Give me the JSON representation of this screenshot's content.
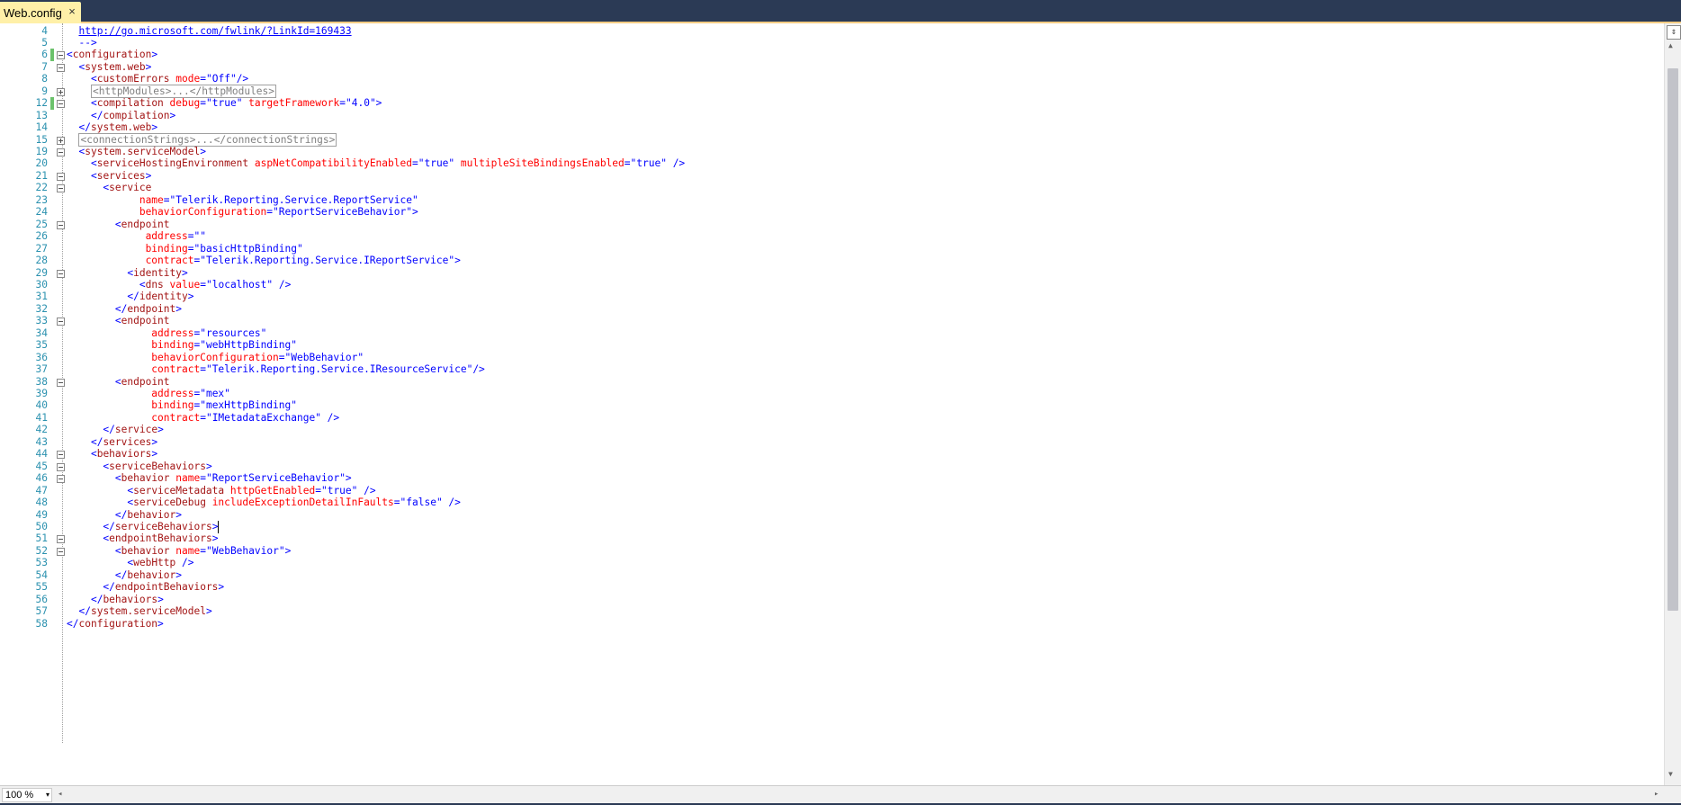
{
  "tab": {
    "title": "Web.config",
    "close_glyph": "×"
  },
  "zoom": {
    "value": "100 %",
    "dropdown_glyph": "▾"
  },
  "scroll": {
    "split_glyph": "⇕",
    "up_glyph": "▲",
    "down_glyph": "▼",
    "left_glyph": "◂",
    "right_glyph": "▸"
  },
  "colors": {
    "element": "#a31515",
    "attribute": "#ff0000",
    "value": "#0000ff",
    "line_number": "#2b91af",
    "change_bar": "#6cc26c"
  },
  "lines": [
    {
      "n": "4",
      "indent": 1,
      "fold": "",
      "chg": false,
      "tokens": [
        [
          "u",
          "http://go.microsoft.com/fwlink/?LinkId=169433"
        ]
      ]
    },
    {
      "n": "5",
      "indent": 1,
      "fold": "",
      "chg": false,
      "tokens": [
        [
          "b",
          "-->"
        ]
      ]
    },
    {
      "n": "6",
      "indent": 0,
      "fold": "minus",
      "chg": true,
      "tokens": [
        [
          "b",
          "<"
        ],
        [
          "t",
          "configuration"
        ],
        [
          "b",
          ">"
        ]
      ]
    },
    {
      "n": "7",
      "indent": 1,
      "fold": "minus",
      "chg": false,
      "tokens": [
        [
          "b",
          "<"
        ],
        [
          "t",
          "system.web"
        ],
        [
          "b",
          ">"
        ]
      ]
    },
    {
      "n": "8",
      "indent": 2,
      "fold": "",
      "chg": false,
      "tokens": [
        [
          "b",
          "<"
        ],
        [
          "t",
          "customErrors"
        ],
        [
          "b",
          " "
        ],
        [
          "a",
          "mode"
        ],
        [
          "b",
          "="
        ],
        [
          "b",
          "\""
        ],
        [
          "v",
          "Off"
        ],
        [
          "b",
          "\"/>"
        ]
      ]
    },
    {
      "n": "9",
      "indent": 2,
      "fold": "plus",
      "chg": false,
      "tokens": [
        [
          "c",
          "<httpModules>...</httpModules>"
        ]
      ]
    },
    {
      "n": "12",
      "indent": 2,
      "fold": "minus",
      "chg": true,
      "tokens": [
        [
          "b",
          "<"
        ],
        [
          "t",
          "compilation"
        ],
        [
          "b",
          " "
        ],
        [
          "a",
          "debug"
        ],
        [
          "b",
          "="
        ],
        [
          "b",
          "\""
        ],
        [
          "v",
          "true"
        ],
        [
          "b",
          "\" "
        ],
        [
          "a",
          "targetFramework"
        ],
        [
          "b",
          "="
        ],
        [
          "b",
          "\""
        ],
        [
          "v",
          "4.0"
        ],
        [
          "b",
          "\">"
        ]
      ]
    },
    {
      "n": "13",
      "indent": 2,
      "fold": "",
      "chg": false,
      "tokens": [
        [
          "b",
          "</"
        ],
        [
          "t",
          "compilation"
        ],
        [
          "b",
          ">"
        ]
      ]
    },
    {
      "n": "14",
      "indent": 1,
      "fold": "",
      "chg": false,
      "tokens": [
        [
          "b",
          "</"
        ],
        [
          "t",
          "system.web"
        ],
        [
          "b",
          ">"
        ]
      ]
    },
    {
      "n": "15",
      "indent": 1,
      "fold": "plus",
      "chg": false,
      "tokens": [
        [
          "c",
          "<connectionStrings>...</connectionStrings>"
        ]
      ]
    },
    {
      "n": "19",
      "indent": 1,
      "fold": "minus",
      "chg": false,
      "tokens": [
        [
          "b",
          "<"
        ],
        [
          "t",
          "system.serviceModel"
        ],
        [
          "b",
          ">"
        ]
      ]
    },
    {
      "n": "20",
      "indent": 2,
      "fold": "",
      "chg": false,
      "tokens": [
        [
          "b",
          "<"
        ],
        [
          "t",
          "serviceHostingEnvironment"
        ],
        [
          "b",
          " "
        ],
        [
          "a",
          "aspNetCompatibilityEnabled"
        ],
        [
          "b",
          "="
        ],
        [
          "b",
          "\""
        ],
        [
          "v",
          "true"
        ],
        [
          "b",
          "\" "
        ],
        [
          "a",
          "multipleSiteBindingsEnabled"
        ],
        [
          "b",
          "="
        ],
        [
          "b",
          "\""
        ],
        [
          "v",
          "true"
        ],
        [
          "b",
          "\" />"
        ]
      ]
    },
    {
      "n": "21",
      "indent": 2,
      "fold": "minus",
      "chg": false,
      "tokens": [
        [
          "b",
          "<"
        ],
        [
          "t",
          "services"
        ],
        [
          "b",
          ">"
        ]
      ]
    },
    {
      "n": "22",
      "indent": 3,
      "fold": "minus",
      "chg": false,
      "tokens": [
        [
          "b",
          "<"
        ],
        [
          "t",
          "service"
        ]
      ]
    },
    {
      "n": "23",
      "indent": 0,
      "pad": "            ",
      "fold": "",
      "chg": false,
      "tokens": [
        [
          "a",
          "name"
        ],
        [
          "b",
          "="
        ],
        [
          "b",
          "\""
        ],
        [
          "v",
          "Telerik.Reporting.Service.ReportService"
        ],
        [
          "b",
          "\""
        ]
      ]
    },
    {
      "n": "24",
      "indent": 0,
      "pad": "            ",
      "fold": "",
      "chg": false,
      "tokens": [
        [
          "a",
          "behaviorConfiguration"
        ],
        [
          "b",
          "="
        ],
        [
          "b",
          "\""
        ],
        [
          "v",
          "ReportServiceBehavior"
        ],
        [
          "b",
          "\">"
        ]
      ]
    },
    {
      "n": "25",
      "indent": 4,
      "fold": "minus",
      "chg": false,
      "tokens": [
        [
          "b",
          "<"
        ],
        [
          "t",
          "endpoint"
        ]
      ]
    },
    {
      "n": "26",
      "indent": 0,
      "pad": "             ",
      "fold": "",
      "chg": false,
      "tokens": [
        [
          "a",
          "address"
        ],
        [
          "b",
          "="
        ],
        [
          "b",
          "\"\""
        ]
      ]
    },
    {
      "n": "27",
      "indent": 0,
      "pad": "             ",
      "fold": "",
      "chg": false,
      "tokens": [
        [
          "a",
          "binding"
        ],
        [
          "b",
          "="
        ],
        [
          "b",
          "\""
        ],
        [
          "v",
          "basicHttpBinding"
        ],
        [
          "b",
          "\""
        ]
      ]
    },
    {
      "n": "28",
      "indent": 0,
      "pad": "             ",
      "fold": "",
      "chg": false,
      "tokens": [
        [
          "a",
          "contract"
        ],
        [
          "b",
          "="
        ],
        [
          "b",
          "\""
        ],
        [
          "v",
          "Telerik.Reporting.Service.IReportService"
        ],
        [
          "b",
          "\">"
        ]
      ]
    },
    {
      "n": "29",
      "indent": 5,
      "fold": "minus",
      "chg": false,
      "tokens": [
        [
          "b",
          "<"
        ],
        [
          "t",
          "identity"
        ],
        [
          "b",
          ">"
        ]
      ]
    },
    {
      "n": "30",
      "indent": 6,
      "fold": "",
      "chg": false,
      "tokens": [
        [
          "b",
          "<"
        ],
        [
          "t",
          "dns"
        ],
        [
          "b",
          " "
        ],
        [
          "a",
          "value"
        ],
        [
          "b",
          "="
        ],
        [
          "b",
          "\""
        ],
        [
          "v",
          "localhost"
        ],
        [
          "b",
          "\" />"
        ]
      ]
    },
    {
      "n": "31",
      "indent": 5,
      "fold": "",
      "chg": false,
      "tokens": [
        [
          "b",
          "</"
        ],
        [
          "t",
          "identity"
        ],
        [
          "b",
          ">"
        ]
      ]
    },
    {
      "n": "32",
      "indent": 4,
      "fold": "",
      "chg": false,
      "tokens": [
        [
          "b",
          "</"
        ],
        [
          "t",
          "endpoint"
        ],
        [
          "b",
          ">"
        ]
      ]
    },
    {
      "n": "33",
      "indent": 4,
      "fold": "minus",
      "chg": false,
      "tokens": [
        [
          "b",
          "<"
        ],
        [
          "t",
          "endpoint"
        ]
      ]
    },
    {
      "n": "34",
      "indent": 0,
      "pad": "              ",
      "fold": "",
      "chg": false,
      "tokens": [
        [
          "a",
          "address"
        ],
        [
          "b",
          "="
        ],
        [
          "b",
          "\""
        ],
        [
          "v",
          "resources"
        ],
        [
          "b",
          "\""
        ]
      ]
    },
    {
      "n": "35",
      "indent": 0,
      "pad": "              ",
      "fold": "",
      "chg": false,
      "tokens": [
        [
          "a",
          "binding"
        ],
        [
          "b",
          "="
        ],
        [
          "b",
          "\""
        ],
        [
          "v",
          "webHttpBinding"
        ],
        [
          "b",
          "\""
        ]
      ]
    },
    {
      "n": "36",
      "indent": 0,
      "pad": "              ",
      "fold": "",
      "chg": false,
      "tokens": [
        [
          "a",
          "behaviorConfiguration"
        ],
        [
          "b",
          "="
        ],
        [
          "b",
          "\""
        ],
        [
          "v",
          "WebBehavior"
        ],
        [
          "b",
          "\""
        ]
      ]
    },
    {
      "n": "37",
      "indent": 0,
      "pad": "              ",
      "fold": "",
      "chg": false,
      "tokens": [
        [
          "a",
          "contract"
        ],
        [
          "b",
          "="
        ],
        [
          "b",
          "\""
        ],
        [
          "v",
          "Telerik.Reporting.Service.IResourceService"
        ],
        [
          "b",
          "\"/>"
        ]
      ]
    },
    {
      "n": "38",
      "indent": 4,
      "fold": "minus",
      "chg": false,
      "tokens": [
        [
          "b",
          "<"
        ],
        [
          "t",
          "endpoint"
        ]
      ]
    },
    {
      "n": "39",
      "indent": 0,
      "pad": "              ",
      "fold": "",
      "chg": false,
      "tokens": [
        [
          "a",
          "address"
        ],
        [
          "b",
          "="
        ],
        [
          "b",
          "\""
        ],
        [
          "v",
          "mex"
        ],
        [
          "b",
          "\""
        ]
      ]
    },
    {
      "n": "40",
      "indent": 0,
      "pad": "              ",
      "fold": "",
      "chg": false,
      "tokens": [
        [
          "a",
          "binding"
        ],
        [
          "b",
          "="
        ],
        [
          "b",
          "\""
        ],
        [
          "v",
          "mexHttpBinding"
        ],
        [
          "b",
          "\""
        ]
      ]
    },
    {
      "n": "41",
      "indent": 0,
      "pad": "              ",
      "fold": "",
      "chg": false,
      "tokens": [
        [
          "a",
          "contract"
        ],
        [
          "b",
          "="
        ],
        [
          "b",
          "\""
        ],
        [
          "v",
          "IMetadataExchange"
        ],
        [
          "b",
          "\" />"
        ]
      ]
    },
    {
      "n": "42",
      "indent": 3,
      "fold": "",
      "chg": false,
      "tokens": [
        [
          "b",
          "</"
        ],
        [
          "t",
          "service"
        ],
        [
          "b",
          ">"
        ]
      ]
    },
    {
      "n": "43",
      "indent": 2,
      "fold": "",
      "chg": false,
      "tokens": [
        [
          "b",
          "</"
        ],
        [
          "t",
          "services"
        ],
        [
          "b",
          ">"
        ]
      ]
    },
    {
      "n": "44",
      "indent": 2,
      "fold": "minus",
      "chg": false,
      "tokens": [
        [
          "b",
          "<"
        ],
        [
          "t",
          "behaviors"
        ],
        [
          "b",
          ">"
        ]
      ]
    },
    {
      "n": "45",
      "indent": 3,
      "fold": "minus",
      "chg": false,
      "tokens": [
        [
          "b",
          "<"
        ],
        [
          "t",
          "serviceBehaviors"
        ],
        [
          "b",
          ">"
        ]
      ]
    },
    {
      "n": "46",
      "indent": 4,
      "fold": "minus",
      "chg": false,
      "tokens": [
        [
          "b",
          "<"
        ],
        [
          "t",
          "behavior"
        ],
        [
          "b",
          " "
        ],
        [
          "a",
          "name"
        ],
        [
          "b",
          "="
        ],
        [
          "b",
          "\""
        ],
        [
          "v",
          "ReportServiceBehavior"
        ],
        [
          "b",
          "\">"
        ]
      ]
    },
    {
      "n": "47",
      "indent": 5,
      "fold": "",
      "chg": false,
      "tokens": [
        [
          "b",
          "<"
        ],
        [
          "t",
          "serviceMetadata"
        ],
        [
          "b",
          " "
        ],
        [
          "a",
          "httpGetEnabled"
        ],
        [
          "b",
          "="
        ],
        [
          "b",
          "\""
        ],
        [
          "v",
          "true"
        ],
        [
          "b",
          "\" />"
        ]
      ]
    },
    {
      "n": "48",
      "indent": 5,
      "fold": "",
      "chg": false,
      "tokens": [
        [
          "b",
          "<"
        ],
        [
          "t",
          "serviceDebug"
        ],
        [
          "b",
          " "
        ],
        [
          "a",
          "includeExceptionDetailInFaults"
        ],
        [
          "b",
          "="
        ],
        [
          "b",
          "\""
        ],
        [
          "v",
          "false"
        ],
        [
          "b",
          "\" />"
        ]
      ]
    },
    {
      "n": "49",
      "indent": 4,
      "fold": "",
      "chg": false,
      "tokens": [
        [
          "b",
          "</"
        ],
        [
          "t",
          "behavior"
        ],
        [
          "b",
          ">"
        ]
      ]
    },
    {
      "n": "50",
      "indent": 3,
      "fold": "",
      "chg": false,
      "caret": true,
      "tokens": [
        [
          "b",
          "</"
        ],
        [
          "t",
          "serviceBehaviors"
        ],
        [
          "b",
          ">"
        ]
      ]
    },
    {
      "n": "51",
      "indent": 3,
      "fold": "minus",
      "chg": false,
      "tokens": [
        [
          "b",
          "<"
        ],
        [
          "t",
          "endpointBehaviors"
        ],
        [
          "b",
          ">"
        ]
      ]
    },
    {
      "n": "52",
      "indent": 4,
      "fold": "minus",
      "chg": false,
      "tokens": [
        [
          "b",
          "<"
        ],
        [
          "t",
          "behavior"
        ],
        [
          "b",
          " "
        ],
        [
          "a",
          "name"
        ],
        [
          "b",
          "="
        ],
        [
          "b",
          "\""
        ],
        [
          "v",
          "WebBehavior"
        ],
        [
          "b",
          "\">"
        ]
      ]
    },
    {
      "n": "53",
      "indent": 5,
      "fold": "",
      "chg": false,
      "tokens": [
        [
          "b",
          "<"
        ],
        [
          "t",
          "webHttp"
        ],
        [
          "b",
          " />"
        ]
      ]
    },
    {
      "n": "54",
      "indent": 4,
      "fold": "",
      "chg": false,
      "tokens": [
        [
          "b",
          "</"
        ],
        [
          "t",
          "behavior"
        ],
        [
          "b",
          ">"
        ]
      ]
    },
    {
      "n": "55",
      "indent": 3,
      "fold": "",
      "chg": false,
      "tokens": [
        [
          "b",
          "</"
        ],
        [
          "t",
          "endpointBehaviors"
        ],
        [
          "b",
          ">"
        ]
      ]
    },
    {
      "n": "56",
      "indent": 2,
      "fold": "",
      "chg": false,
      "tokens": [
        [
          "b",
          "</"
        ],
        [
          "t",
          "behaviors"
        ],
        [
          "b",
          ">"
        ]
      ]
    },
    {
      "n": "57",
      "indent": 1,
      "fold": "",
      "chg": false,
      "tokens": [
        [
          "b",
          "</"
        ],
        [
          "t",
          "system.serviceModel"
        ],
        [
          "b",
          ">"
        ]
      ]
    },
    {
      "n": "58",
      "indent": 0,
      "fold": "",
      "chg": false,
      "tokens": [
        [
          "b",
          "</"
        ],
        [
          "t",
          "configuration"
        ],
        [
          "b",
          ">"
        ]
      ]
    }
  ]
}
